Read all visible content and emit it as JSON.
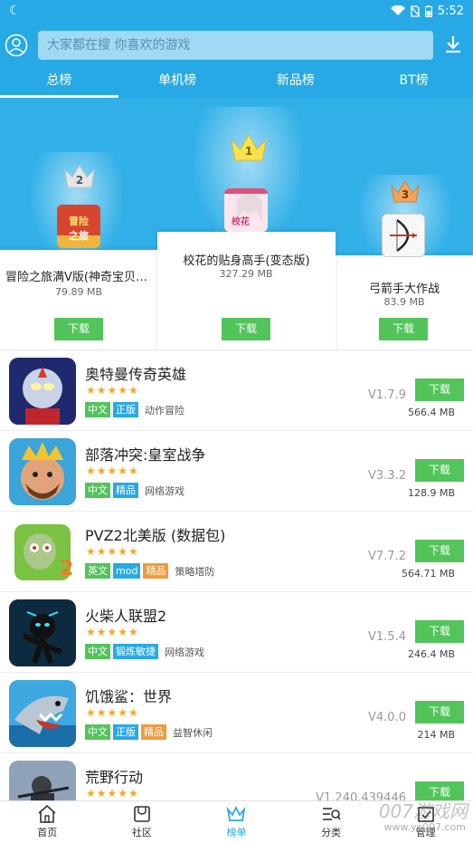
{
  "status": {
    "time": "5:52"
  },
  "search": {
    "placeholder": "大家都在搜 你喜欢的游戏"
  },
  "tabs": [
    {
      "label": "总榜",
      "active": true
    },
    {
      "label": "单机榜",
      "active": false
    },
    {
      "label": "新品榜",
      "active": false
    },
    {
      "label": "BT榜",
      "active": false
    }
  ],
  "podium": [
    {
      "rank": "2",
      "name": "冒险之旅满V版(神奇宝贝X...",
      "size": "79.89 MB",
      "button": "下载",
      "icon_text": "冒险之旅"
    },
    {
      "rank": "1",
      "name": "校花的贴身高手(变态版)",
      "size": "327.29 MB",
      "button": "下载",
      "icon_text": "校花"
    },
    {
      "rank": "3",
      "name": "弓箭手大作战",
      "size": "83.9 MB",
      "button": "下载"
    }
  ],
  "apps": [
    {
      "name": "奥特曼传奇英雄",
      "rating": 5,
      "tags": [
        {
          "text": "中文",
          "color": "green"
        },
        {
          "text": "正版",
          "color": "blue"
        }
      ],
      "category": "动作冒险",
      "version": "V1.7.9",
      "size": "566.4 MB",
      "button": "下载"
    },
    {
      "name": "部落冲突:皇室战争",
      "rating": 5,
      "tags": [
        {
          "text": "中文",
          "color": "green"
        },
        {
          "text": "精品",
          "color": "blue"
        }
      ],
      "category": "网络游戏",
      "version": "V3.3.2",
      "size": "128.9 MB",
      "button": "下载"
    },
    {
      "name": "PVZ2北美版 (数据包)",
      "rating": 5,
      "tags": [
        {
          "text": "英文",
          "color": "green"
        },
        {
          "text": "mod",
          "color": "blue"
        },
        {
          "text": "精品",
          "color": "orange"
        }
      ],
      "category": "策略塔防",
      "version": "V7.7.2",
      "size": "564.71 MB",
      "button": "下载"
    },
    {
      "name": "火柴人联盟2",
      "rating": 5,
      "tags": [
        {
          "text": "中文",
          "color": "green"
        },
        {
          "text": "锻炼敏捷",
          "color": "blue"
        }
      ],
      "category": "网络游戏",
      "version": "V1.5.4",
      "size": "246.4 MB",
      "button": "下载"
    },
    {
      "name": "饥饿鲨：世界",
      "rating": 5,
      "tags": [
        {
          "text": "中文",
          "color": "green"
        },
        {
          "text": "正版",
          "color": "blue"
        },
        {
          "text": "精品",
          "color": "orange"
        }
      ],
      "category": "益智休闲",
      "version": "V4.0.0",
      "size": "214 MB",
      "button": "下载"
    },
    {
      "name": "荒野行动",
      "rating": 5,
      "tags": [],
      "category": "",
      "version": "V1.240.439446",
      "size": "",
      "button": "下载"
    }
  ],
  "nav": [
    {
      "label": "首页",
      "icon": "home-icon",
      "active": false
    },
    {
      "label": "社区",
      "icon": "community-icon",
      "active": false
    },
    {
      "label": "榜单",
      "icon": "crown-icon",
      "active": true
    },
    {
      "label": "分类",
      "icon": "category-icon",
      "active": false
    },
    {
      "label": "管理",
      "icon": "manage-icon",
      "active": false
    }
  ],
  "watermark": {
    "main": "007游戏网",
    "url": "www.yx007.com"
  },
  "colors": {
    "primary": "#27a9e6",
    "download": "#52c45a",
    "star": "#f6a623",
    "tag_orange": "#f09a3e"
  }
}
